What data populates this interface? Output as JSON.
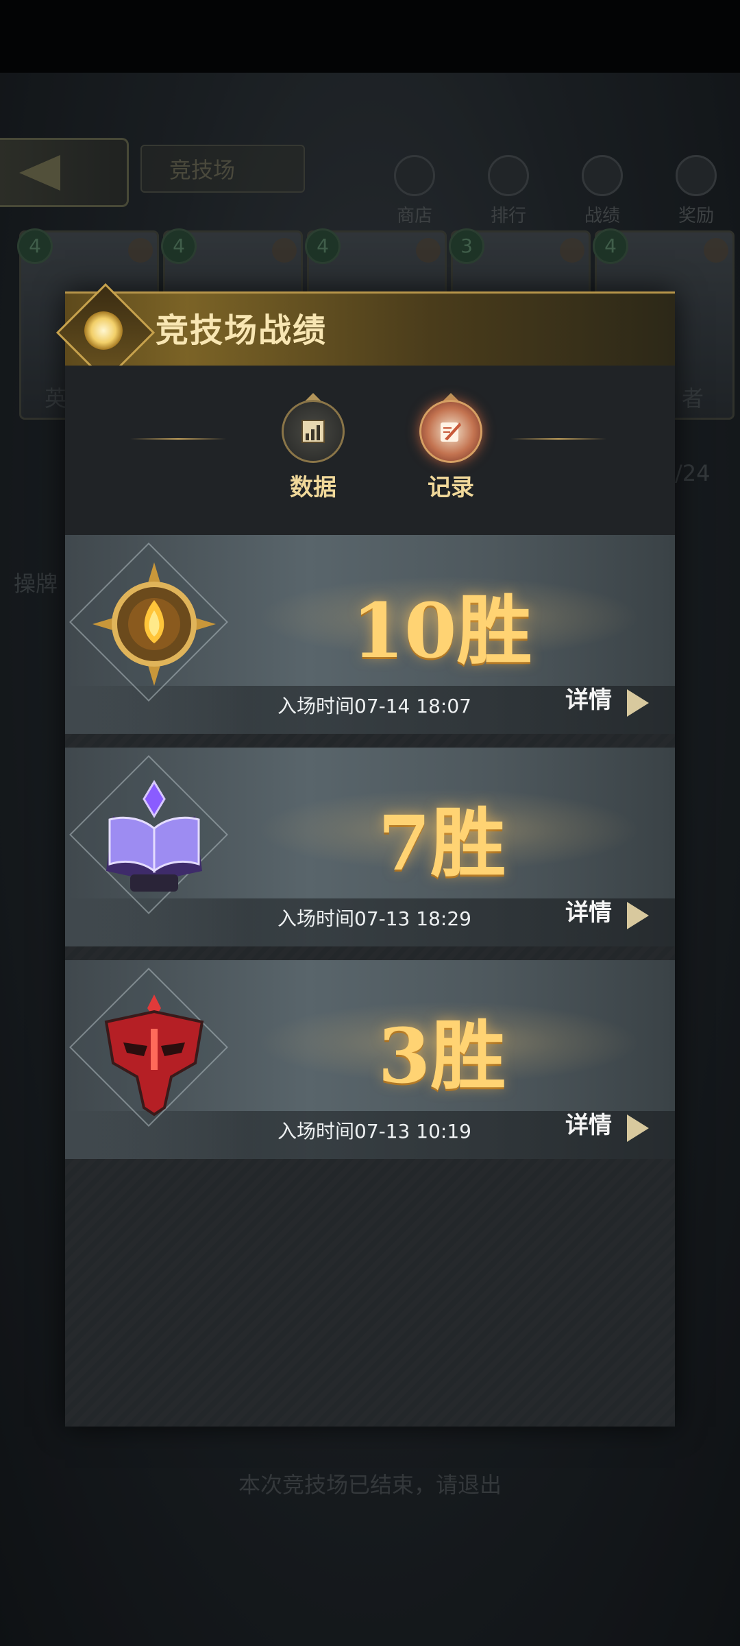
{
  "background": {
    "title": "竞技场",
    "nav": [
      {
        "label": "商店",
        "icon": "shop-icon"
      },
      {
        "label": "排行",
        "icon": "trophy-icon"
      },
      {
        "label": "战绩",
        "icon": "record-icon"
      },
      {
        "label": "奖励",
        "icon": "reward-icon"
      }
    ],
    "card_costs": [
      "4",
      "4",
      "4",
      "3",
      "4"
    ],
    "side_texts": [
      "英",
      "操牌",
      "者",
      "/24"
    ],
    "footer_message": "本次竞技场已结束，请退出"
  },
  "panel": {
    "title": "竞技场战绩",
    "tabs": [
      {
        "label": "数据",
        "icon": "chart-icon",
        "active": false
      },
      {
        "label": "记录",
        "icon": "quill-icon",
        "active": true
      }
    ],
    "records": [
      {
        "wins": "10胜",
        "time": "入场时间07-14 18:07",
        "detail": "详情",
        "badge": "gold-sun-badge"
      },
      {
        "wins": "7胜",
        "time": "入场时间07-13 18:29",
        "detail": "详情",
        "badge": "purple-book-badge"
      },
      {
        "wins": "3胜",
        "time": "入场时间07-13 10:19",
        "detail": "详情",
        "badge": "red-mask-badge"
      }
    ]
  },
  "colors": {
    "gold": "#ffd373",
    "header_gold": "#7b6326",
    "panel_bg": "#23272a"
  }
}
